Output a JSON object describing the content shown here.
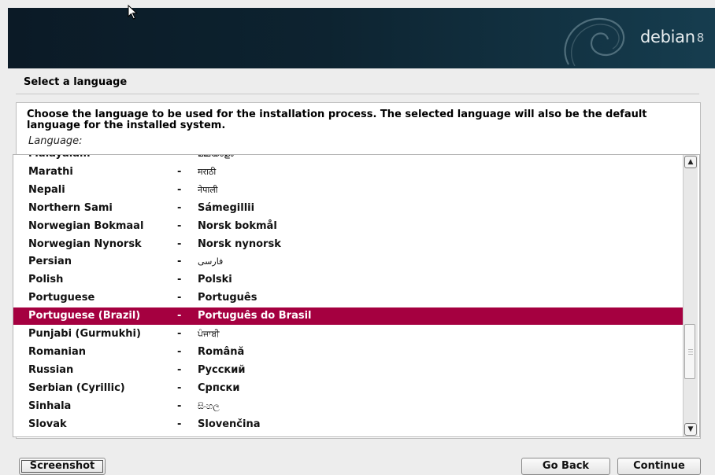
{
  "banner": {
    "brand": "debian",
    "version": "8"
  },
  "page": {
    "title": "Select a language"
  },
  "question": {
    "text": "Choose the language to be used for the installation process. The selected language will also be the default language for the installed system.",
    "field_label": "Language:"
  },
  "languages": [
    {
      "name": "Malayalam",
      "native": "മലയാളം",
      "partial": true
    },
    {
      "name": "Marathi",
      "native": "मराठी"
    },
    {
      "name": "Nepali",
      "native": "नेपाली"
    },
    {
      "name": "Northern Sami",
      "native": "Sámegillii"
    },
    {
      "name": "Norwegian Bokmaal",
      "native": "Norsk bokmål"
    },
    {
      "name": "Norwegian Nynorsk",
      "native": "Norsk nynorsk"
    },
    {
      "name": "Persian",
      "native": "فارسی"
    },
    {
      "name": "Polish",
      "native": "Polski"
    },
    {
      "name": "Portuguese",
      "native": "Português"
    },
    {
      "name": "Portuguese (Brazil)",
      "native": "Português do Brasil",
      "selected": true
    },
    {
      "name": "Punjabi (Gurmukhi)",
      "native": "ਪੰਜਾਬੀ"
    },
    {
      "name": "Romanian",
      "native": "Română"
    },
    {
      "name": "Russian",
      "native": "Русский"
    },
    {
      "name": "Serbian (Cyrillic)",
      "native": "Српски"
    },
    {
      "name": "Sinhala",
      "native": "සිංහල"
    },
    {
      "name": "Slovak",
      "native": "Slovenčina"
    }
  ],
  "separator": "-",
  "scrollbar": {
    "up_icon": "^",
    "down_icon": "v"
  },
  "buttons": {
    "screenshot": "Screenshot",
    "go_back": "Go Back",
    "continue": "Continue"
  },
  "colors": {
    "selection": "#a50040",
    "banner": "#0d2330"
  }
}
